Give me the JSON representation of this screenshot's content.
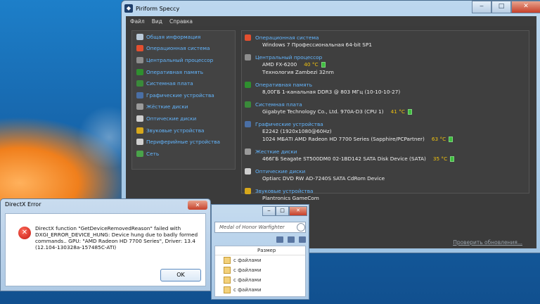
{
  "speccy": {
    "title": "Piriform Speccy",
    "menu": [
      "Файл",
      "Вид",
      "Справка"
    ],
    "nav": [
      {
        "label": "Общая информация",
        "icon": "summary-icon",
        "color": "#b9c9d8"
      },
      {
        "label": "Операционная система",
        "icon": "windows-icon",
        "color": "#e34f2f"
      },
      {
        "label": "Центральный процессор",
        "icon": "cpu-icon",
        "color": "#8d8d8d"
      },
      {
        "label": "Оперативная память",
        "icon": "ram-icon",
        "color": "#2f8f2f"
      },
      {
        "label": "Системная плата",
        "icon": "motherboard-icon",
        "color": "#3a8a3a"
      },
      {
        "label": "Графические устройства",
        "icon": "monitor-icon",
        "color": "#4a6fa5"
      },
      {
        "label": "Жёсткие диски",
        "icon": "hdd-icon",
        "color": "#9a9a9a"
      },
      {
        "label": "Оптические диски",
        "icon": "disc-icon",
        "color": "#cfcfcf"
      },
      {
        "label": "Звуковые устройства",
        "icon": "speaker-icon",
        "color": "#d7a81b"
      },
      {
        "label": "Периферийные устройства",
        "icon": "mouse-icon",
        "color": "#d0d0d0"
      },
      {
        "label": "Сеть",
        "icon": "network-icon",
        "color": "#4aa34a"
      }
    ],
    "sections": [
      {
        "title": "Операционная система",
        "icon": "windows-icon",
        "color": "#e34f2f",
        "lines": [
          {
            "text": "Windows 7 Профессиональная 64-bit SP1",
            "temp": ""
          }
        ]
      },
      {
        "title": "Центральный процессор",
        "icon": "cpu-icon",
        "color": "#8d8d8d",
        "lines": [
          {
            "text": "AMD FX-6200",
            "temp": "40 °C"
          },
          {
            "text": "Технология Zambezi 32nm",
            "temp": ""
          }
        ]
      },
      {
        "title": "Оперативная память",
        "icon": "ram-icon",
        "color": "#2f8f2f",
        "lines": [
          {
            "text": "8,00ГБ 1-канальная DDR3 @ 803 МГц (10-10-10-27)",
            "temp": ""
          }
        ]
      },
      {
        "title": "Системная плата",
        "icon": "motherboard-icon",
        "color": "#3a8a3a",
        "lines": [
          {
            "text": "Gigabyte Technology Co., Ltd. 970A-D3 (CPU 1)",
            "temp": "41 °C"
          }
        ]
      },
      {
        "title": "Графические устройства",
        "icon": "monitor-icon",
        "color": "#4a6fa5",
        "lines": [
          {
            "text": "E2242 (1920x1080@60Hz)",
            "temp": ""
          },
          {
            "text": "1024 МБАТI AMD Radeon HD 7700 Series (Sapphire/PCPartner)",
            "temp": "63 °C"
          }
        ]
      },
      {
        "title": "Жесткие диски",
        "icon": "hdd-icon",
        "color": "#9a9a9a",
        "lines": [
          {
            "text": "466ГБ Seagate ST500DM0 02-1BD142 SATA Disk Device (SATA)",
            "temp": "35 °C"
          }
        ]
      },
      {
        "title": "Оптические диски",
        "icon": "disc-icon",
        "color": "#cfcfcf",
        "lines": [
          {
            "text": "Optiarc DVD RW AD-7240S SATA CdRom Device",
            "temp": ""
          }
        ]
      },
      {
        "title": "Звуковые устройства",
        "icon": "speaker-icon",
        "color": "#d7a81b",
        "lines": [
          {
            "text": "Plantronics GameCom",
            "temp": ""
          }
        ]
      }
    ],
    "check_updates": "Проверить обновления..."
  },
  "explorer": {
    "address": "Medal of Honor Warfighter",
    "column": "Размер",
    "rows": [
      "с файлами",
      "с файлами",
      "с файлами",
      "с файлами"
    ]
  },
  "dialog": {
    "title": "DirectX Error",
    "message_lines": [
      "DirectX function \"GetDeviceRemovedReason\" failed with",
      "DXGI_ERROR_DEVICE_HUNG: Device hung due to badly formed",
      "commands.. GPU: \"AMD Radeon HD 7700 Series\", Driver: 13.4",
      "(12.104-130328a-157485C-ATI)"
    ],
    "ok_label": "OK"
  }
}
